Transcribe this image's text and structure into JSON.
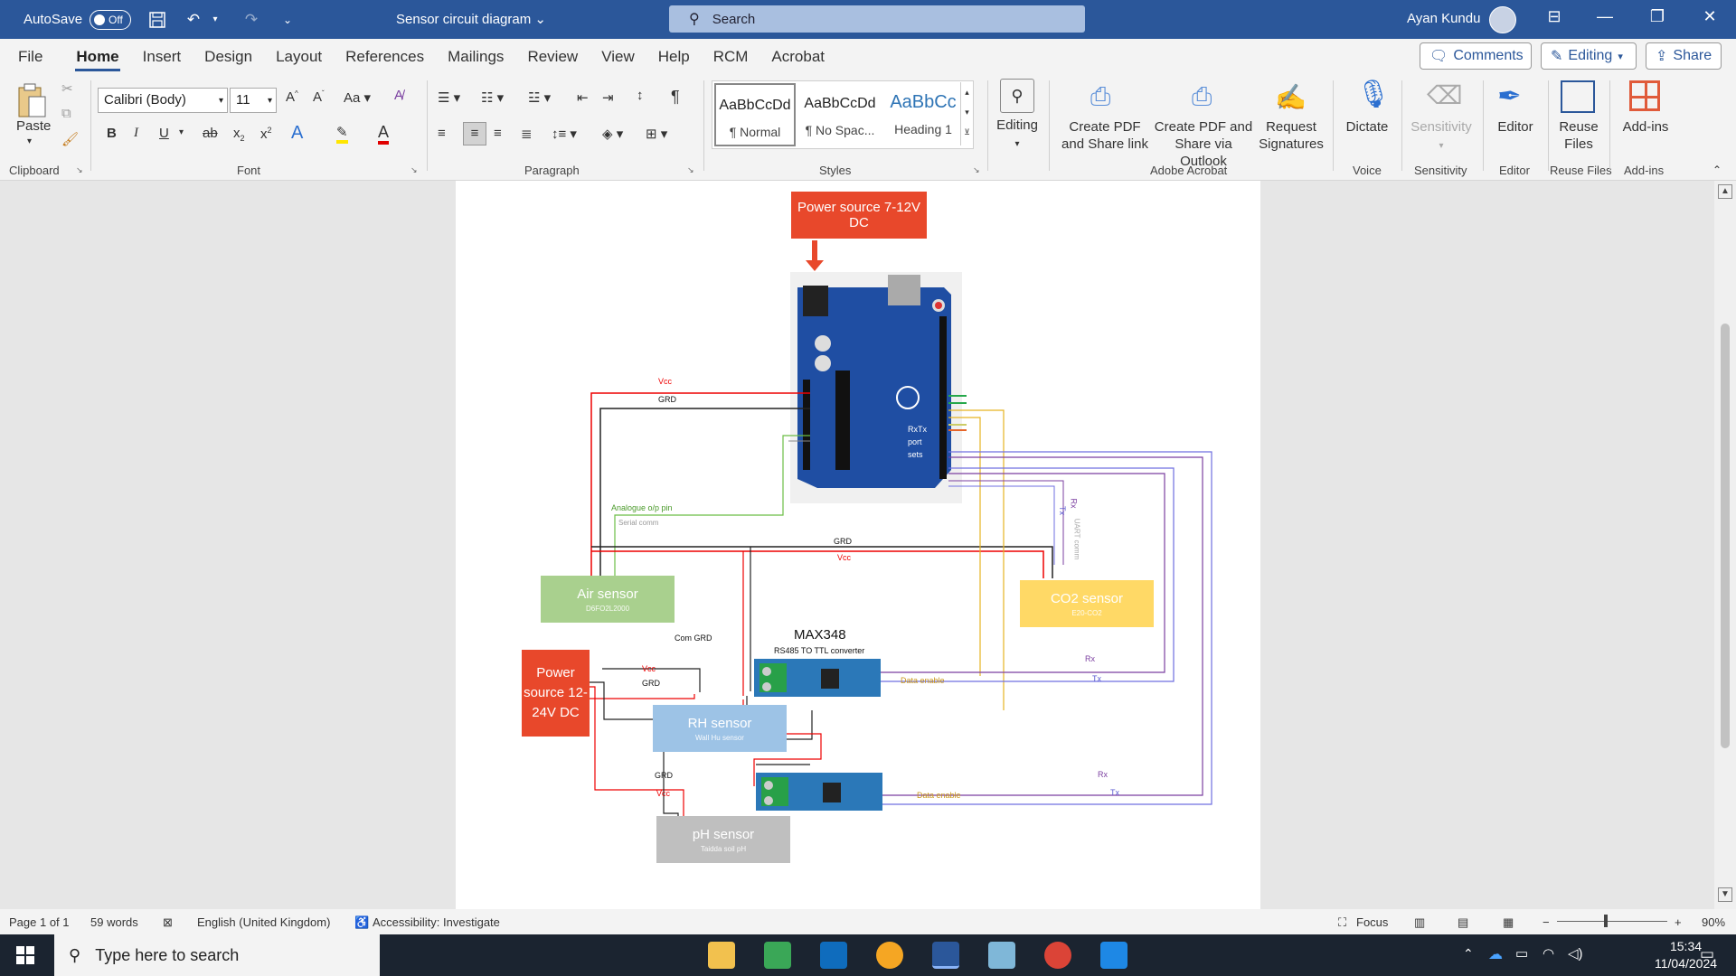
{
  "titlebar": {
    "autosave_label": "AutoSave",
    "autosave_state": "Off",
    "doc_name": "Sensor circuit diagram",
    "search_placeholder": "Search",
    "user_name": "Ayan Kundu"
  },
  "tabs": [
    "File",
    "Home",
    "Insert",
    "Design",
    "Layout",
    "References",
    "Mailings",
    "Review",
    "View",
    "Help",
    "RCM",
    "Acrobat"
  ],
  "tab_actions": {
    "comments": "Comments",
    "editing": "Editing",
    "share": "Share"
  },
  "ribbon": {
    "clipboard": {
      "paste": "Paste",
      "label": "Clipboard"
    },
    "font": {
      "name": "Calibri (Body)",
      "size": "11",
      "label": "Font",
      "case": "Aa"
    },
    "paragraph": {
      "label": "Paragraph"
    },
    "styles": {
      "label": "Styles",
      "items": [
        {
          "sample": "AaBbCcDd",
          "name": "¶ Normal"
        },
        {
          "sample": "AaBbCcDd",
          "name": "¶ No Spac..."
        },
        {
          "sample": "AaBbCc",
          "name": "Heading 1"
        }
      ]
    },
    "editing": {
      "label": "Editing"
    },
    "acrobat": {
      "label": "Adobe Acrobat",
      "create_pdf": "Create PDF and Share link",
      "create_pdf_outlook": "Create PDF and Share via Outlook",
      "request_signatures": "Request Signatures"
    },
    "voice": {
      "dictate": "Dictate",
      "label": "Voice"
    },
    "sensitivity": {
      "button": "Sensitivity",
      "label": "Sensitivity"
    },
    "editor": {
      "button": "Editor",
      "label": "Editor"
    },
    "reuse": {
      "button": "Reuse Files",
      "label": "Reuse Files"
    },
    "addins": {
      "button": "Add-ins",
      "label": "Add-ins"
    }
  },
  "diagram": {
    "power_top": "Power source 7-12V DC",
    "rxtx": "RxTx port sets",
    "air_sensor": {
      "title": "Air sensor",
      "sub": "D6FO2L2000"
    },
    "co2_sensor": {
      "title": "CO2 sensor",
      "sub": "E20-CO2"
    },
    "power_left": "Power source 12-24V DC",
    "rh_sensor": {
      "title": "RH sensor",
      "sub": "Wall Hu sensor"
    },
    "ph_sensor": {
      "title": "pH sensor",
      "sub": "Taidda soil pH"
    },
    "max348": "MAX348",
    "converter": "RS485 TO TTL converter",
    "labels": {
      "vcc": "Vcc",
      "grd": "GRD",
      "analogue": "Analogue o/p pin",
      "serial": "Serial comm",
      "com_grd": "Com GRD",
      "data_enable": "Data enable",
      "rx": "Rx",
      "tx": "Tx",
      "uart": "UART comm"
    },
    "colors": {
      "power": "#e8482b",
      "air": "#a9d08e",
      "co2": "#ffd966",
      "rh": "#9dc3e6",
      "ph": "#bfbfbf",
      "board": "#1f4ea3"
    }
  },
  "status": {
    "page": "Page 1 of 1",
    "words": "59 words",
    "language": "English (United Kingdom)",
    "accessibility": "Accessibility: Investigate",
    "focus": "Focus",
    "zoom": "90%"
  },
  "taskbar": {
    "search_placeholder": "Type here to search",
    "time": "15:34",
    "date": "11/04/2024"
  }
}
